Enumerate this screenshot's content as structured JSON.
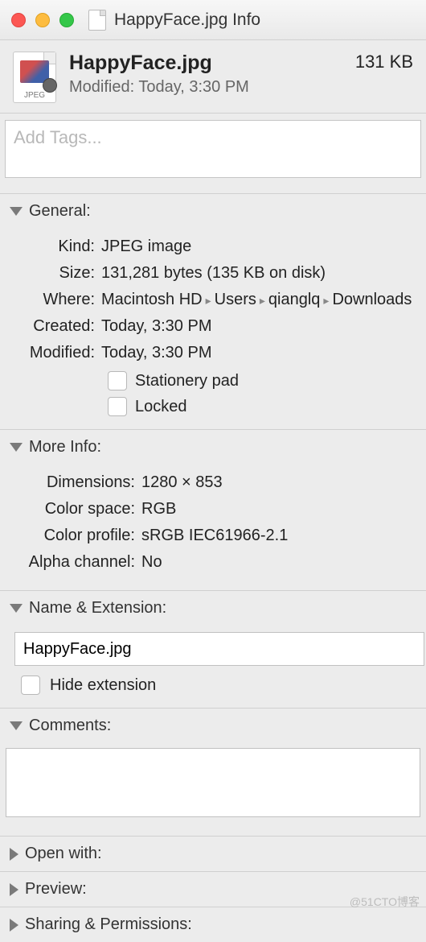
{
  "window": {
    "title": "HappyFace.jpg Info"
  },
  "header": {
    "filename": "HappyFace.jpg",
    "modified_line": "Modified: Today, 3:30 PM",
    "size": "131 KB",
    "icon_sub": "JPEG"
  },
  "tags": {
    "placeholder": "Add Tags..."
  },
  "sections": {
    "general": {
      "title": "General:",
      "kind_label": "Kind:",
      "kind_value": "JPEG image",
      "size_label": "Size:",
      "size_value": "131,281 bytes (135 KB on disk)",
      "where_label": "Where:",
      "where_parts": [
        "Macintosh HD",
        "Users",
        "qianglq",
        "Downloads"
      ],
      "created_label": "Created:",
      "created_value": "Today, 3:30 PM",
      "modified_label": "Modified:",
      "modified_value": "Today, 3:30 PM",
      "stationery_label": "Stationery pad",
      "locked_label": "Locked"
    },
    "moreinfo": {
      "title": "More Info:",
      "dimensions_label": "Dimensions:",
      "dimensions_value": "1280 × 853",
      "colorspace_label": "Color space:",
      "colorspace_value": "RGB",
      "colorprofile_label": "Color profile:",
      "colorprofile_value": "sRGB IEC61966-2.1",
      "alpha_label": "Alpha channel:",
      "alpha_value": "No"
    },
    "nameext": {
      "title": "Name & Extension:",
      "value": "HappyFace.jpg",
      "hide_ext_label": "Hide extension"
    },
    "comments": {
      "title": "Comments:",
      "value": ""
    },
    "openwith": {
      "title": "Open with:"
    },
    "preview": {
      "title": "Preview:"
    },
    "sharing": {
      "title": "Sharing & Permissions:"
    }
  },
  "watermark": "@51CTO博客"
}
